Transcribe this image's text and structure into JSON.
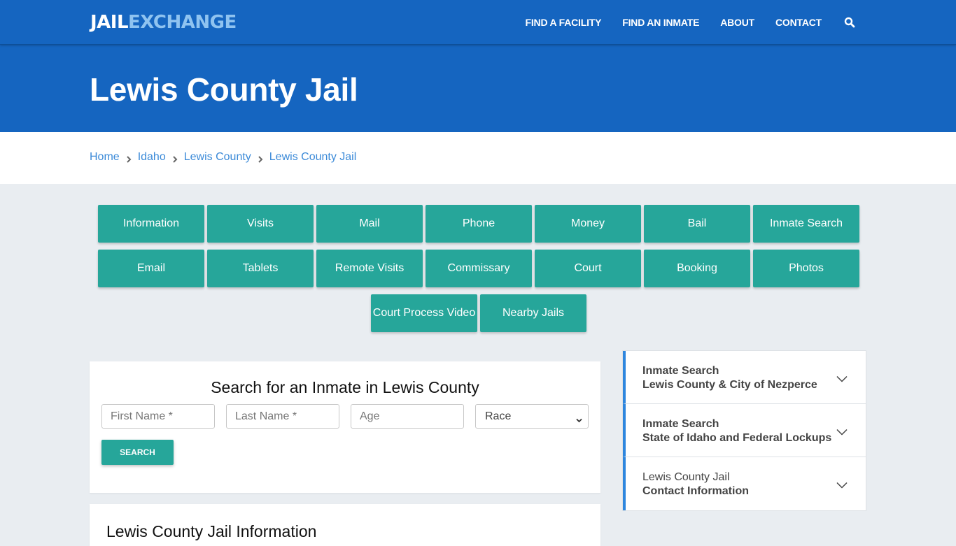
{
  "header": {
    "logo_part1": "JAIL",
    "logo_part2": "EXCHANGE",
    "nav": [
      {
        "label": "FIND A FACILITY"
      },
      {
        "label": "FIND AN INMATE"
      },
      {
        "label": "ABOUT"
      },
      {
        "label": "CONTACT"
      }
    ],
    "search_icon": "search-icon"
  },
  "hero": {
    "title": "Lewis County Jail"
  },
  "breadcrumb": [
    {
      "label": "Home"
    },
    {
      "label": "Idaho"
    },
    {
      "label": "Lewis County"
    },
    {
      "label": "Lewis County Jail"
    }
  ],
  "quick_links": {
    "row1": [
      "Information",
      "Visits",
      "Mail",
      "Phone",
      "Money",
      "Bail",
      "Inmate Search"
    ],
    "row2": [
      "Email",
      "Tablets",
      "Remote Visits",
      "Commissary",
      "Court",
      "Booking",
      "Photos"
    ],
    "row3": [
      "Court Process Video",
      "Nearby Jails"
    ]
  },
  "search_form": {
    "title": "Search for an Inmate in Lewis County",
    "first_name_placeholder": "First Name *",
    "last_name_placeholder": "Last Name *",
    "age_placeholder": "Age",
    "race_selected": "Race",
    "submit_label": "SEARCH"
  },
  "info_section": {
    "title": "Lewis County Jail Information"
  },
  "sidebar": {
    "items": [
      {
        "line1": "Inmate Search",
        "line2": "Lewis County & City of Nezperce",
        "line1_bold": true
      },
      {
        "line1": "Inmate Search",
        "line2": "State of Idaho and Federal Lockups",
        "line1_bold": true
      },
      {
        "line1": "Lewis County Jail",
        "line2": "Contact Information",
        "line1_bold": false
      }
    ]
  },
  "colors": {
    "brand_blue": "#1565c0",
    "logo_accent": "#8fc3f0",
    "teal_button": "#26a69a",
    "link_blue": "#3b8ad8",
    "accordion_accent": "#2e86de"
  }
}
